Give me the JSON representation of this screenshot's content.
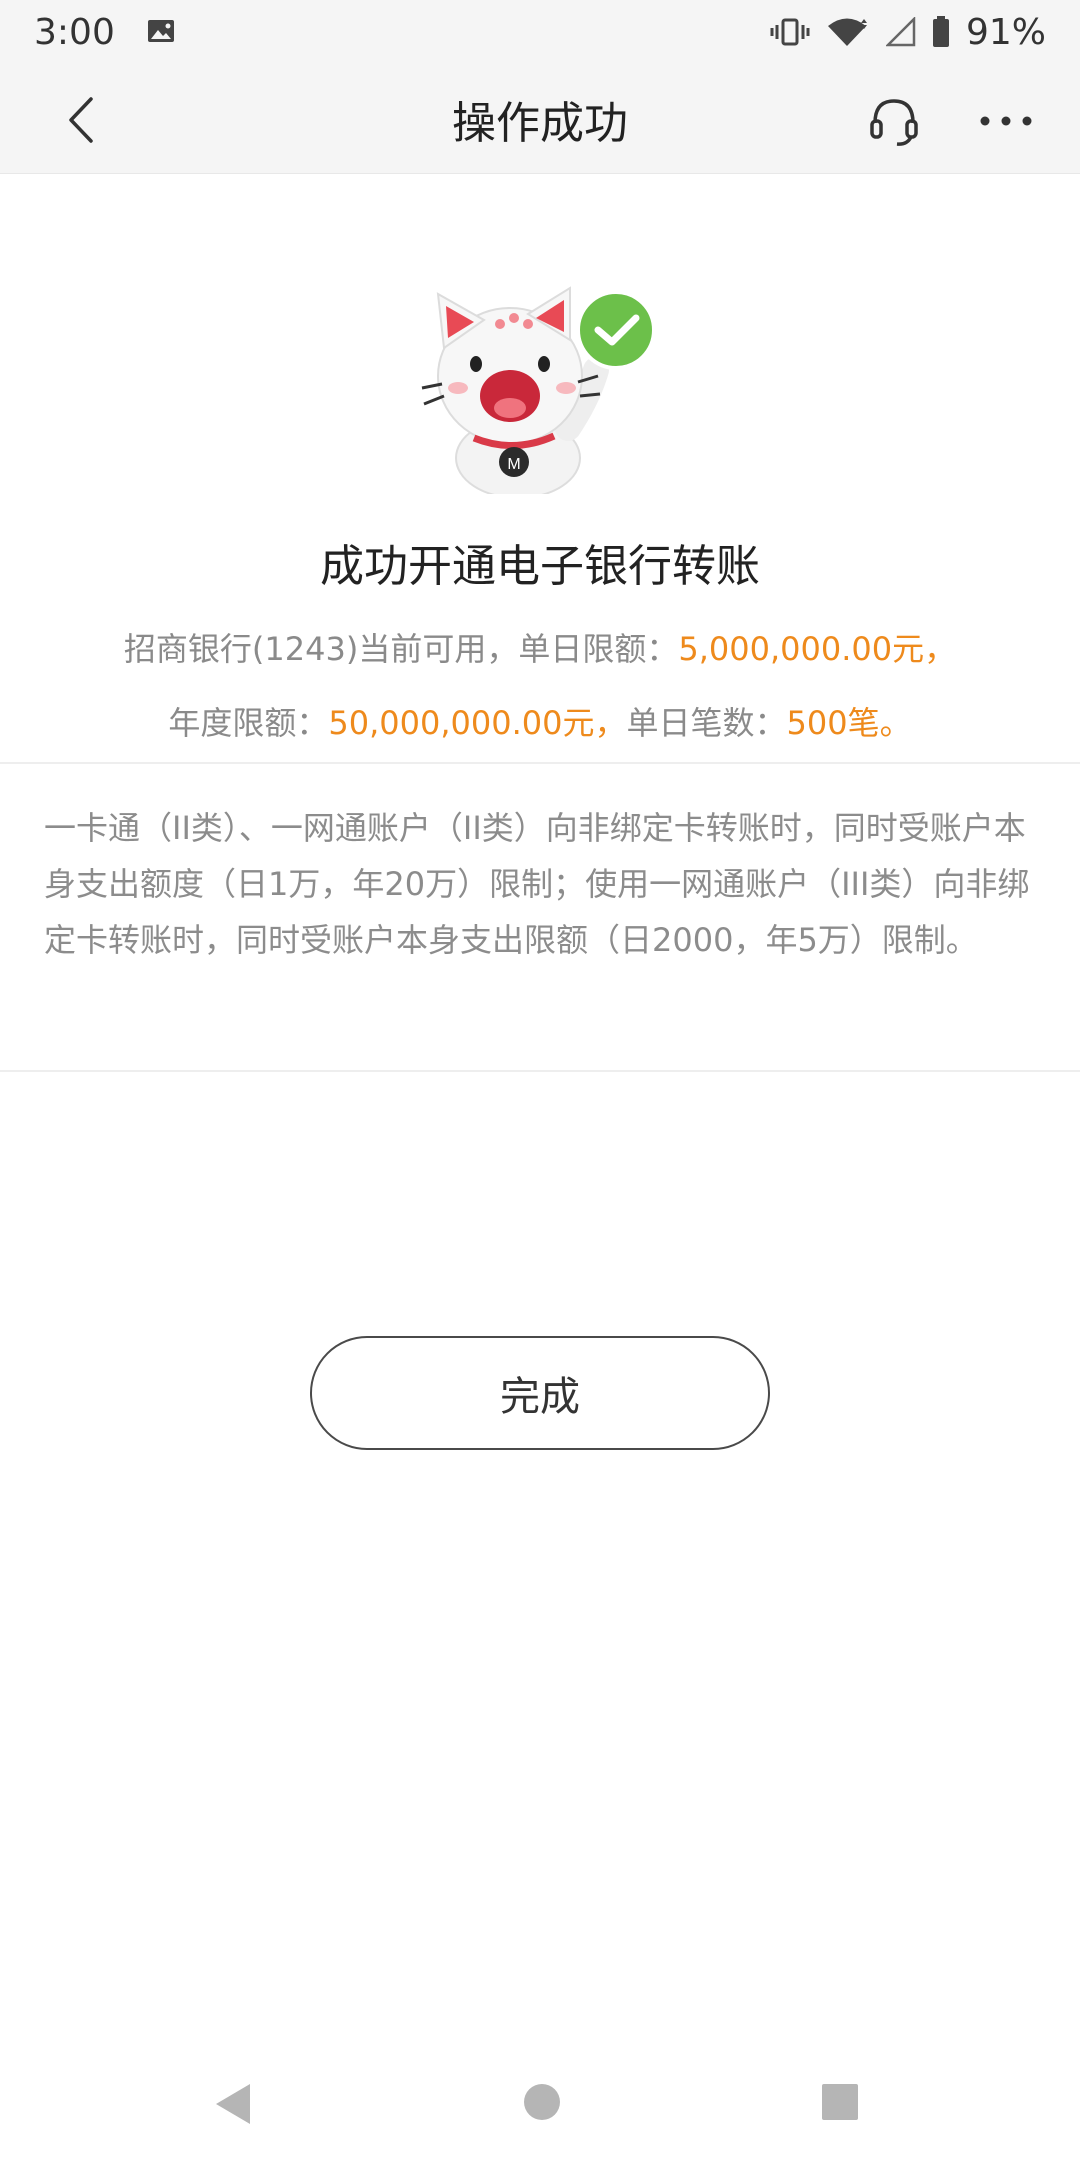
{
  "status_bar": {
    "time": "3:00",
    "battery": "91%",
    "icons": [
      "image-notification-icon",
      "vibrate-icon",
      "wifi-icon",
      "signal-icon",
      "battery-icon"
    ]
  },
  "header": {
    "title": "操作成功",
    "back_icon": "chevron-left-icon",
    "service_icon": "headset-icon",
    "more_icon": "more-dots-icon"
  },
  "result": {
    "title": "成功开通电子银行转账",
    "line1_prefix": "招商银行(1243)当前可用，单日限额：",
    "daily_limit": "5,000,000.00元，",
    "line2_prefix": "年度限额：",
    "annual_limit": "50,000,000.00元，",
    "line2_mid": "单日笔数：",
    "daily_count": "500笔。"
  },
  "notice": {
    "text": "一卡通（II类）、一网通账户（II类）向非绑定卡转账时，同时受账户本身支出额度（日1万，年20万）限制；使用一网通账户（III类）向非绑定卡转账时，同时受账户本身支出限额（日2000，年5万）限制。"
  },
  "actions": {
    "done_label": "完成"
  },
  "colors": {
    "accent_orange": "#ee8a1c",
    "check_green": "#6cc04a",
    "header_bg": "#f5f5f5"
  }
}
